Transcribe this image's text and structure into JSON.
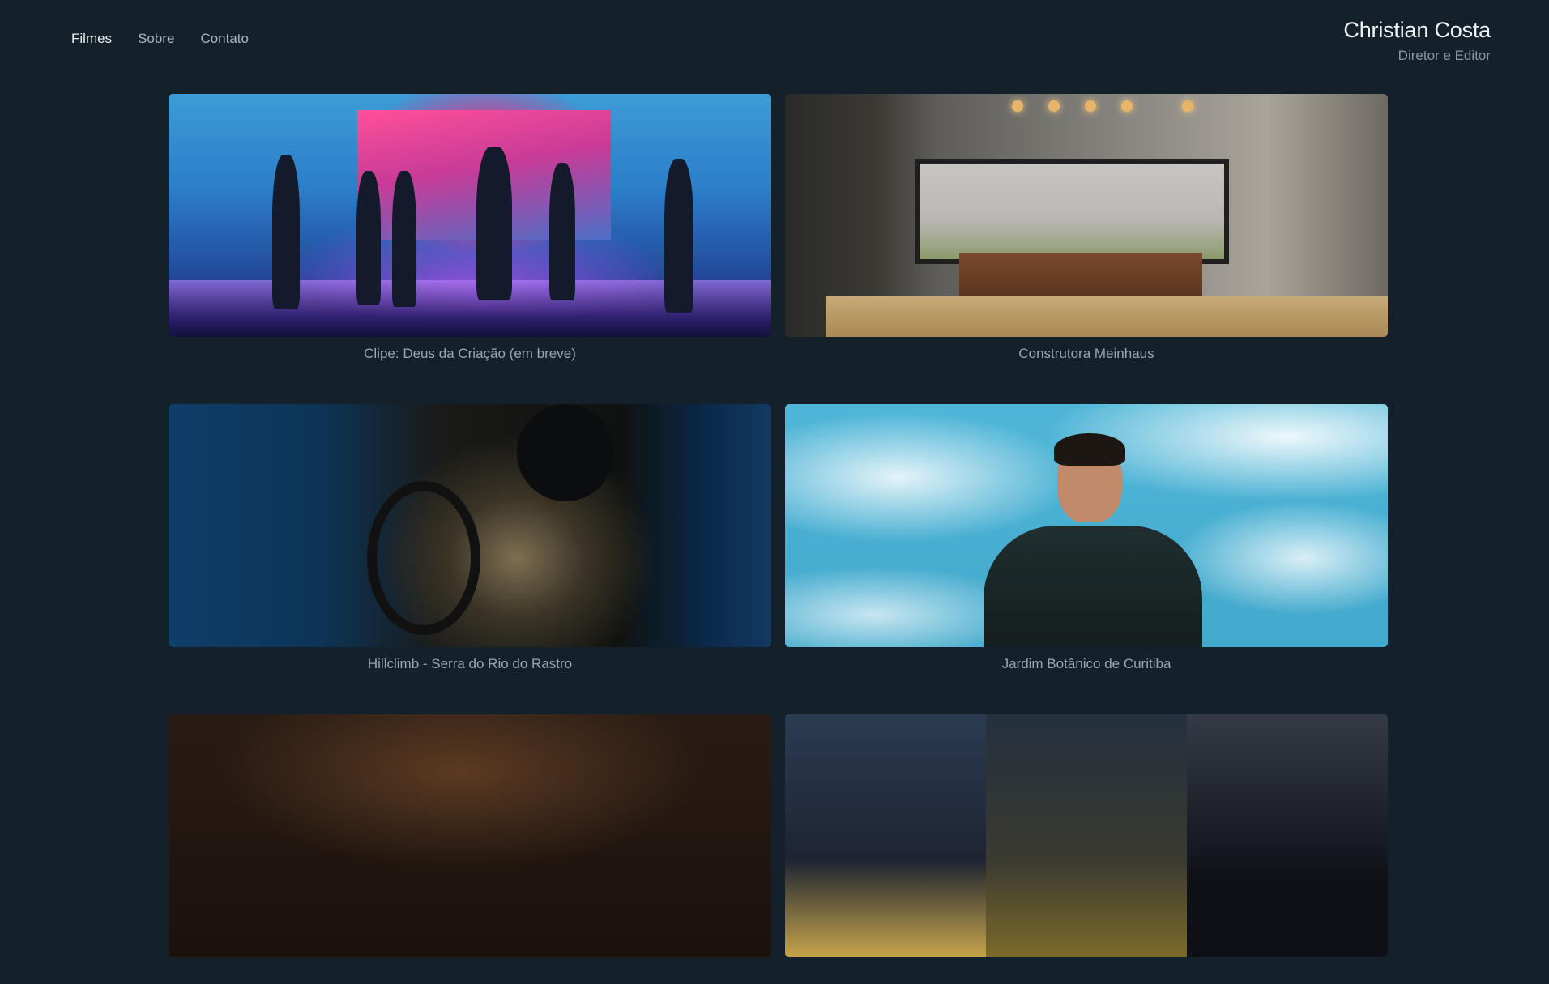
{
  "nav": {
    "items": [
      {
        "label": "Filmes",
        "active": true
      },
      {
        "label": "Sobre",
        "active": false
      },
      {
        "label": "Contato",
        "active": false
      }
    ]
  },
  "brand": {
    "name": "Christian Costa",
    "role": "Diretor e Editor"
  },
  "films": [
    {
      "caption": "Clipe: Deus da Criação (em breve)"
    },
    {
      "caption": "Construtora Meinhaus"
    },
    {
      "caption": "Hillclimb - Serra do Rio do Rastro"
    },
    {
      "caption": "Jardim Botânico de Curitiba"
    },
    {
      "caption": ""
    },
    {
      "caption": ""
    }
  ],
  "colors": {
    "background": "#14212a",
    "nav_active": "#e8eef1",
    "nav_inactive": "#a9b6bd",
    "caption": "#9aa7ae"
  }
}
